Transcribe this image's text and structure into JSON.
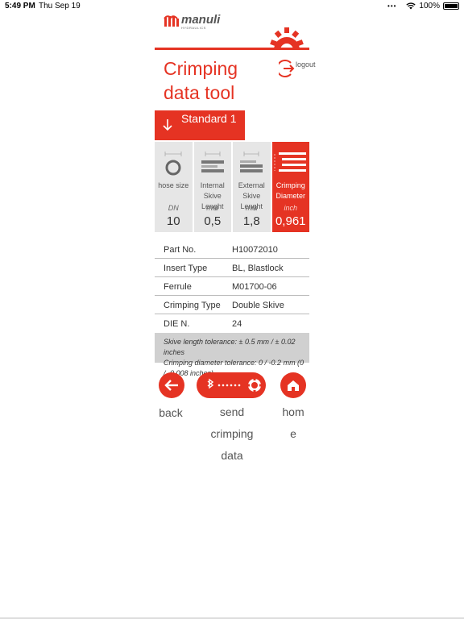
{
  "status_bar": {
    "time": "5:49 PM",
    "date": "Thu Sep 19",
    "battery": "100%"
  },
  "brand": {
    "name": "manuli",
    "sub": "HYDRAULICS"
  },
  "header": {
    "title_line1": "Crimping",
    "title_line2": "data tool",
    "logout_label": "logout"
  },
  "standard": {
    "label": "Standard 1"
  },
  "tiles": [
    {
      "name": "hose size",
      "unit": "DN",
      "value": "10"
    },
    {
      "name": "Internal Skive Lenght",
      "unit": "mm",
      "value": "0,5"
    },
    {
      "name": "External Skive Lenght",
      "unit": "mm",
      "value": "1,8"
    },
    {
      "name": "Crimping Diameter",
      "unit": "inch",
      "value": "0,961"
    }
  ],
  "details": [
    {
      "key": "Part No.",
      "value": "H10072010"
    },
    {
      "key": "Insert Type",
      "value": "BL, Blastlock"
    },
    {
      "key": "Ferrule",
      "value": "M01700-06"
    },
    {
      "key": "Crimping Type",
      "value": "Double Skive"
    },
    {
      "key": "DIE N.",
      "value": "24"
    }
  ],
  "tolerance": {
    "skive": "Skive length tolerance: ± 0.5 mm / ± 0.02 inches",
    "crimping": "Crimping diameter tolerance: 0 / -0.2 mm (0 / -0.008 inches)"
  },
  "actions": {
    "back": "back",
    "send_line1": "send",
    "send_line2": "crimping",
    "send_line3": "data",
    "home_line1": "hom",
    "home_line2": "e"
  },
  "colors": {
    "accent": "#e53323",
    "tile_bg": "#e6e6e6",
    "tolerance_bg": "#d0d0d0"
  }
}
